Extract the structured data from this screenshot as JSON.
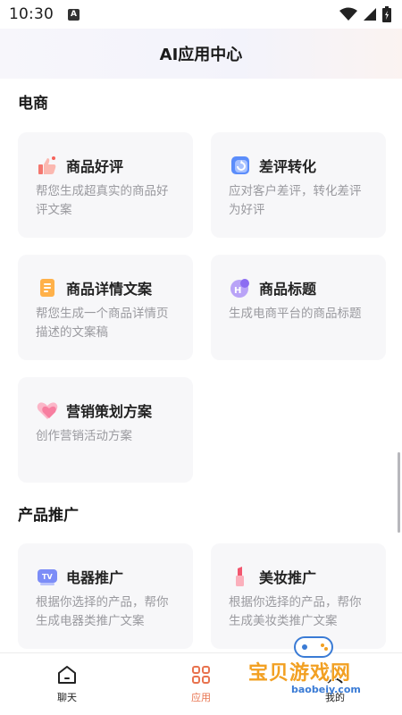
{
  "status_bar": {
    "time": "10:30",
    "notification_badge": "A"
  },
  "header": {
    "title": "AI应用中心"
  },
  "sections": [
    {
      "title": "电商",
      "cards": [
        {
          "icon": "thumbs-up-icon",
          "title": "商品好评",
          "desc": "帮您生成超真实的商品好评文案"
        },
        {
          "icon": "refresh-chat-icon",
          "title": "差评转化",
          "desc": "应对客户差评，转化差评为好评"
        },
        {
          "icon": "document-icon",
          "title": "商品详情文案",
          "desc": "帮您生成一个商品详情页描述的文案稿"
        },
        {
          "icon": "heading-icon",
          "title": "商品标题",
          "desc": "生成电商平台的商品标题"
        },
        {
          "icon": "heart-icon",
          "title": "营销策划方案",
          "desc": "创作营销活动方案"
        }
      ]
    },
    {
      "title": "产品推广",
      "cards": [
        {
          "icon": "tv-icon",
          "title": "电器推广",
          "desc": "根据你选择的产品，帮你生成电器类推广文案"
        },
        {
          "icon": "lipstick-icon",
          "title": "美妆推广",
          "desc": "根据你选择的产品，帮你生成美妆类推广文案"
        }
      ]
    }
  ],
  "bottom_nav": [
    {
      "label": "聊天",
      "icon": "home-icon",
      "active": false
    },
    {
      "label": "应用",
      "icon": "grid-icon",
      "active": true
    },
    {
      "label": "我的",
      "icon": "user-icon",
      "active": false
    }
  ],
  "watermark": {
    "text": "宝贝游戏网",
    "url": "baobeiy.com"
  },
  "colors": {
    "accent": "#e8734f",
    "card_bg": "#f7f7f9",
    "desc_text": "#9a9a9f"
  }
}
